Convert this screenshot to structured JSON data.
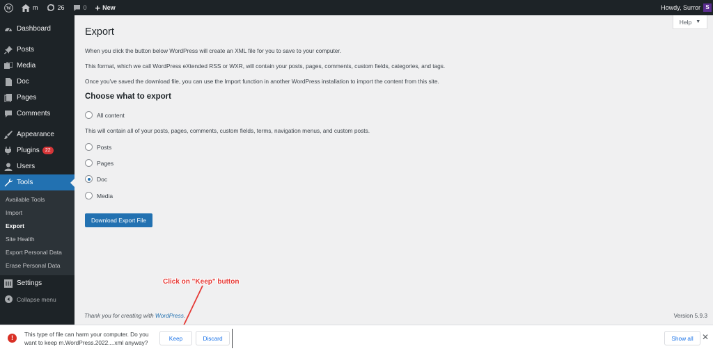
{
  "adminbar": {
    "site_name": "m",
    "updates_count": "26",
    "comments_count": "0",
    "new_label": "New",
    "howdy": "Howdy, Surror",
    "avatar_letter": "S"
  },
  "sidebar": {
    "items": [
      {
        "label": "Dashboard",
        "icon": "dashboard-icon"
      },
      {
        "label": "Posts",
        "icon": "pin-icon"
      },
      {
        "label": "Media",
        "icon": "media-icon"
      },
      {
        "label": "Doc",
        "icon": "doc-icon"
      },
      {
        "label": "Pages",
        "icon": "pages-icon"
      },
      {
        "label": "Comments",
        "icon": "comment-icon"
      },
      {
        "label": "Appearance",
        "icon": "brush-icon"
      },
      {
        "label": "Plugins",
        "icon": "plugin-icon",
        "badge": "22"
      },
      {
        "label": "Users",
        "icon": "user-icon"
      },
      {
        "label": "Tools",
        "icon": "wrench-icon"
      },
      {
        "label": "Settings",
        "icon": "settings-icon"
      },
      {
        "label": "Collapse menu",
        "icon": "collapse-icon"
      }
    ],
    "submenu": [
      "Available Tools",
      "Import",
      "Export",
      "Site Health",
      "Export Personal Data",
      "Erase Personal Data"
    ],
    "active_color": "#2271b1"
  },
  "main": {
    "help_label": "Help",
    "title": "Export",
    "intro": "When you click the button below WordPress will create an XML file for you to save to your computer.",
    "format_text": "This format, which we call WordPress eXtended RSS or WXR, will contain your posts, pages, comments, custom fields, categories, and tags.",
    "import_text": "Once you've saved the download file, you can use the Import function in another WordPress installation to import the content from this site.",
    "choose_heading": "Choose what to export",
    "options": {
      "all_content": "All content",
      "all_desc": "This will contain all of your posts, pages, comments, custom fields, terms, navigation menus, and custom posts.",
      "posts": "Posts",
      "pages": "Pages",
      "doc": "Doc",
      "media": "Media",
      "selected": "Doc"
    },
    "download_button": "Download Export File",
    "footer_thanks": "Thank you for creating with ",
    "footer_link": "WordPress",
    "footer_period": ".",
    "version": "Version 5.9.3"
  },
  "annotation": {
    "text": "Click on \"Keep\" button",
    "color": "#e53935"
  },
  "download_bar": {
    "warning_text": "This type of file can harm your computer. Do you want to keep m.WordPress.2022....xml anyway?",
    "keep_label": "Keep",
    "discard_label": "Discard",
    "show_all_label": "Show all",
    "close_glyph": "✕"
  }
}
